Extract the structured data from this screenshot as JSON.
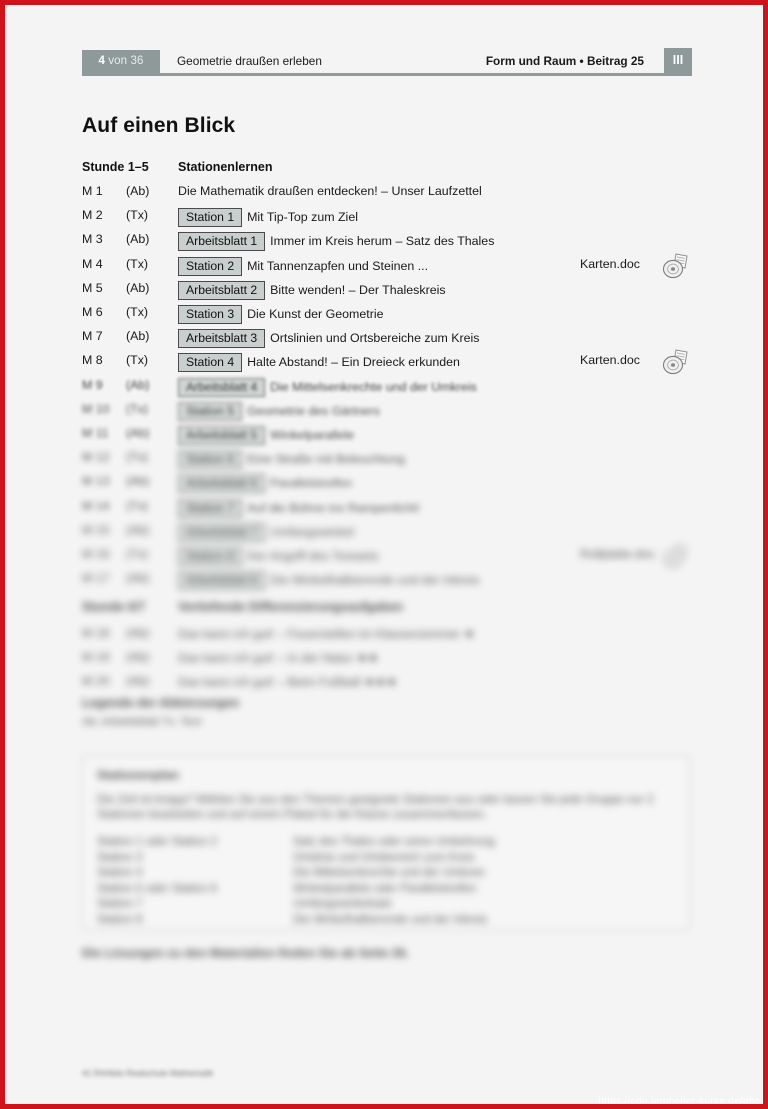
{
  "page": {
    "accent_border_color": "#d0131a",
    "paper_color": "#f4f4f4",
    "header_grey": "#8d9a99",
    "tag_grey": "#c9cfce"
  },
  "header": {
    "page_number": "4",
    "page_number_suffix": " von 36",
    "title": "Geometrie draußen erleben",
    "right_label": "Form und Raum • Beitrag 25",
    "roman_badge": "III"
  },
  "main": {
    "page_title": "Auf einen Blick",
    "closing_note": "Die Lösungen zu den Materialien finden Sie ab Seite 26."
  },
  "section_1": {
    "label": "Stunde 1–5",
    "title": "Stationenlernen",
    "rows": [
      {
        "m": "M 1",
        "type": "(Ab)",
        "tag": "",
        "text": "Die Mathematik draußen entdecken! – Unser Laufzettel",
        "file": "",
        "blur": ""
      },
      {
        "m": "M 2",
        "type": "(Tx)",
        "tag": "Station 1",
        "text": "Mit Tip-Top zum Ziel",
        "file": "",
        "blur": ""
      },
      {
        "m": "M 3",
        "type": "(Ab)",
        "tag": "Arbeitsblatt 1",
        "text": "Immer im Kreis herum – Satz des Thales",
        "file": "",
        "blur": ""
      },
      {
        "m": "M 4",
        "type": "(Tx)",
        "tag": "Station 2",
        "text": "Mit Tannenzapfen und Steinen ...",
        "file": "Karten.doc",
        "blur": ""
      },
      {
        "m": "M 5",
        "type": "(Ab)",
        "tag": "Arbeitsblatt 2",
        "text": "Bitte wenden! – Der Thaleskreis",
        "file": "",
        "blur": ""
      },
      {
        "m": "M 6",
        "type": "(Tx)",
        "tag": "Station 3",
        "text": "Die Kunst der Geometrie",
        "file": "",
        "blur": ""
      },
      {
        "m": "M 7",
        "type": "(Ab)",
        "tag": "Arbeitsblatt 3",
        "text": "Ortslinien und Ortsbereiche zum Kreis",
        "file": "",
        "blur": ""
      },
      {
        "m": "M 8",
        "type": "(Tx)",
        "tag": "Station 4",
        "text": "Halte Abstand! – Ein Dreieck erkunden",
        "file": "Karten.doc",
        "blur": ""
      },
      {
        "m": "M 9",
        "type": "(Ab)",
        "tag": "Arbeitsblatt 4",
        "text": "Die Mittelsenkrechte und der Umkreis",
        "file": "",
        "blur": "b1"
      },
      {
        "m": "M 10",
        "type": "(Tx)",
        "tag": "Station 5",
        "text": "Geometrie des Gärtners",
        "file": "",
        "blur": "b2"
      },
      {
        "m": "M 11",
        "type": "(Ab)",
        "tag": "Arbeitsblatt 5",
        "text": "Winkelparallele",
        "file": "",
        "blur": "b2"
      },
      {
        "m": "M 12",
        "type": "(Tx)",
        "tag": "Station 6",
        "text": "Eine Straße mit Beleuchtung",
        "file": "",
        "blur": "b3"
      },
      {
        "m": "M 13",
        "type": "(Ab)",
        "tag": "Arbeitsblatt 6",
        "text": "Parallelstreifen",
        "file": "",
        "blur": "b3"
      },
      {
        "m": "M 14",
        "type": "(Tx)",
        "tag": "Station 7",
        "text": "Auf die Bühne ins Rampenlicht!",
        "file": "",
        "blur": "b3"
      },
      {
        "m": "M 15",
        "type": "(Ab)",
        "tag": "Arbeitsblatt 7",
        "text": "Umfangswinkel",
        "file": "",
        "blur": "b4"
      },
      {
        "m": "M 16",
        "type": "(Tx)",
        "tag": "Station 8",
        "text": "Der Angriff des Torwarts",
        "file": "Rollplatte.doc",
        "blur": "b4"
      },
      {
        "m": "M 17",
        "type": "(Ab)",
        "tag": "Arbeitsblatt 8",
        "text": "Die Winkelhalbierende und der Inkreis",
        "file": "",
        "blur": "b4"
      }
    ]
  },
  "section_2": {
    "label": "Stunde 6/7",
    "title": "Vertiefende Differenzierungsaufgaben",
    "rows": [
      {
        "m": "M 18",
        "type": "(Ab)",
        "tag": "",
        "text": "Das kann ich gut! – Feuerstellen im Klassenzimmer ★",
        "file": "",
        "blur": "b4"
      },
      {
        "m": "M 19",
        "type": "(Ab)",
        "tag": "",
        "text": "Das kann ich gut! – In der Natur ★★",
        "file": "",
        "blur": "b4"
      },
      {
        "m": "M 20",
        "type": "(Ab)",
        "tag": "",
        "text": "Das kann ich gut! – Beim Fußball ★★★",
        "file": "",
        "blur": "b4"
      }
    ]
  },
  "legend": {
    "title": "Legende der Abkürzungen",
    "line": "Ab: Arbeitsblatt   Tx: Text"
  },
  "plan": {
    "title": "Stationenplan",
    "paragraph": "Die Zeit ist knapp? Wählen Sie aus den Themen geeignete Stationen aus oder lassen Sie jede Gruppe nur 2 Stationen bearbeiten und auf einem Plakat für die Klasse zusammenfassen.",
    "rows": [
      {
        "left": "Station 1 oder Station 2",
        "right": "Satz des Thales oder seine Umkehrung"
      },
      {
        "left": "Station 3",
        "right": "Ortslinie und Ortsbereich zum Kreis"
      },
      {
        "left": "Station 4",
        "right": "Die Mittelsenkrechte und der Umkreis"
      },
      {
        "left": "Station 5 oder Station 6",
        "right": "Winkelparallele oder Parallelstreifen"
      },
      {
        "left": "Station 7",
        "right": "Umfangswinkelsatz"
      },
      {
        "left": "Station 8",
        "right": "Die Winkelhalbierende und der Inkreis"
      }
    ]
  },
  "footer": {
    "imprint": "41 RAAbits Realschule Mathematik",
    "watermark": "https://cdn.lernhelfer-kurse.de/abc"
  },
  "icons": {
    "cd": "cd-disc-icon"
  }
}
